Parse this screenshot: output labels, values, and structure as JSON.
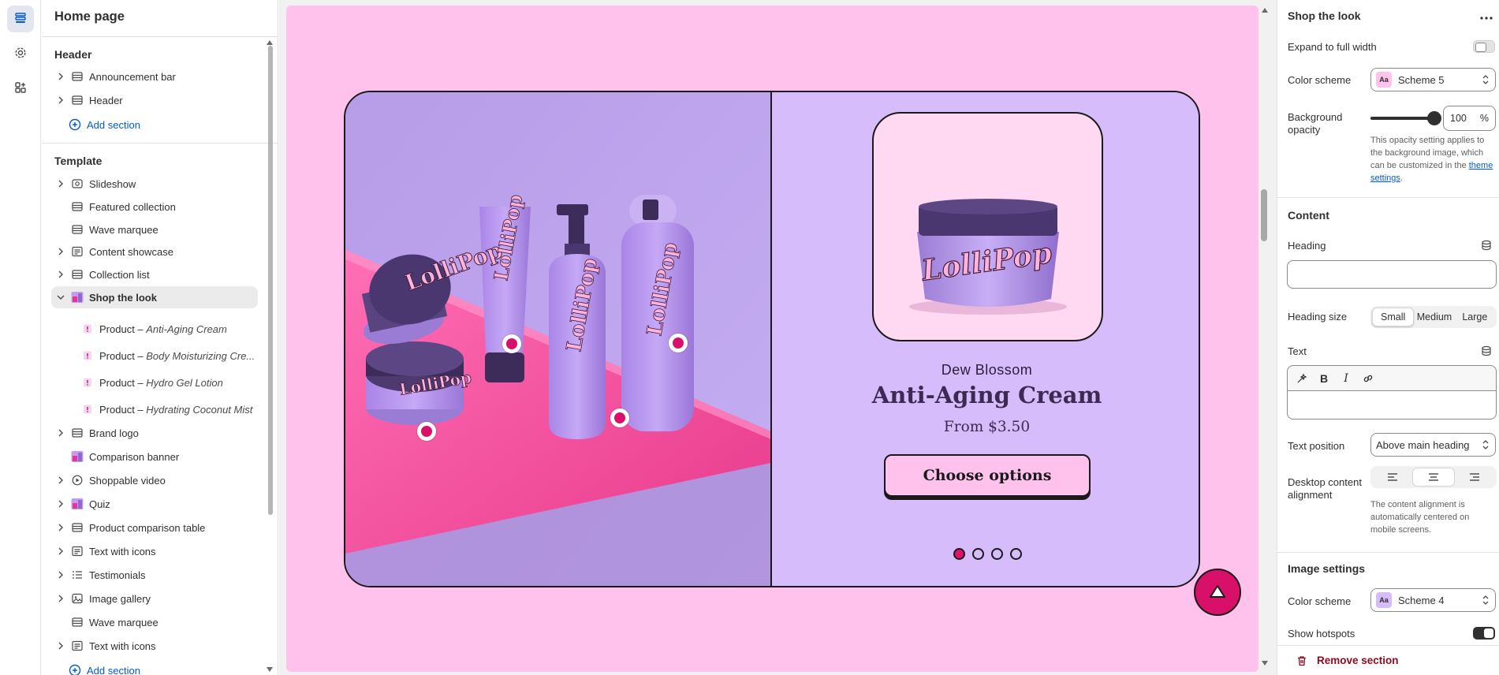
{
  "rail": {
    "items": [
      {
        "name": "sections"
      },
      {
        "name": "settings"
      },
      {
        "name": "apps"
      }
    ]
  },
  "sidebar": {
    "title": "Home page",
    "header_group": "Header",
    "header_items": [
      {
        "label": "Announcement bar",
        "icon": "section-icon"
      },
      {
        "label": "Header",
        "icon": "section-icon"
      }
    ],
    "add_section": "Add section",
    "template_group": "Template",
    "template_items": [
      {
        "label": "Slideshow",
        "icon": "slideshow-icon",
        "expandable": true
      },
      {
        "label": "Featured collection",
        "icon": "section-icon",
        "expandable": false
      },
      {
        "label": "Wave marquee",
        "icon": "section-icon",
        "expandable": false
      },
      {
        "label": "Content showcase",
        "icon": "text-block-icon",
        "expandable": true
      },
      {
        "label": "Collection list",
        "icon": "section-icon",
        "expandable": true
      },
      {
        "label": "Shop the look",
        "icon": "image-thumbnail-icon",
        "expandable": true,
        "selected": true
      }
    ],
    "sub_items": [
      {
        "prefix": "Product – ",
        "name": "Anti-Aging Cream"
      },
      {
        "prefix": "Product – ",
        "name": "Body Moisturizing Cre..."
      },
      {
        "prefix": "Product – ",
        "name": "Hydro Gel Lotion"
      },
      {
        "prefix": "Product – ",
        "name": "Hydrating Coconut Mist"
      }
    ],
    "more_items": [
      {
        "label": "Brand logo",
        "icon": "section-icon",
        "expandable": true
      },
      {
        "label": "Comparison banner",
        "icon": "image-thumbnail-icon",
        "expandable": false
      },
      {
        "label": "Shoppable video",
        "icon": "play-icon",
        "expandable": true
      },
      {
        "label": "Quiz",
        "icon": "image-thumbnail-icon",
        "expandable": true
      },
      {
        "label": "Product comparison table",
        "icon": "section-icon",
        "expandable": true
      },
      {
        "label": "Text with icons",
        "icon": "text-block-icon",
        "expandable": true
      },
      {
        "label": "Testimonials",
        "icon": "list-icon",
        "expandable": true
      },
      {
        "label": "Image gallery",
        "icon": "gallery-icon",
        "expandable": true
      },
      {
        "label": "Wave marquee",
        "icon": "section-icon",
        "expandable": false
      },
      {
        "label": "Text with icons",
        "icon": "text-block-icon",
        "expandable": true
      }
    ],
    "add_section_bottom": "Add section"
  },
  "preview": {
    "vendor": "Dew Blossom",
    "product_title": "Anti-Aging Cream",
    "price": "From $3.50",
    "cta": "Choose options",
    "brand_wordmark": "LolliPop",
    "dots_total": 4,
    "dots_active": 1,
    "colors": {
      "page_bg": "#ffc2ed",
      "card_bg": "#d6bcfa",
      "accent": "#d9106a"
    }
  },
  "settings": {
    "title": "Shop the look",
    "expand_full_width_label": "Expand to full width",
    "expand_full_width": false,
    "color_scheme_label": "Color scheme",
    "color_scheme_value": "Scheme 5",
    "swatch_text": "Aa",
    "background_opacity_label": "Background opacity",
    "background_opacity_value": "100",
    "background_opacity_unit": "%",
    "opacity_help": "This opacity setting applies to the background image, which can be customized in the",
    "opacity_help_link": "theme settings",
    "opacity_help_end": ".",
    "content_heading": "Content",
    "heading_label": "Heading",
    "heading_value": "",
    "heading_size_label": "Heading size",
    "heading_size_options": [
      "Small",
      "Medium",
      "Large"
    ],
    "heading_size_selected": "Small",
    "text_label": "Text",
    "text_position_label": "Text position",
    "text_position_value": "Above main heading",
    "desktop_alignment_label": "Desktop content alignment",
    "alignment_help": "The content alignment is automatically centered on mobile screens.",
    "image_settings_heading": "Image settings",
    "image_color_scheme_label": "Color scheme",
    "image_color_scheme_value": "Scheme 4",
    "show_hotspots_label": "Show hotspots",
    "show_hotspots": true,
    "remove_section": "Remove section"
  }
}
